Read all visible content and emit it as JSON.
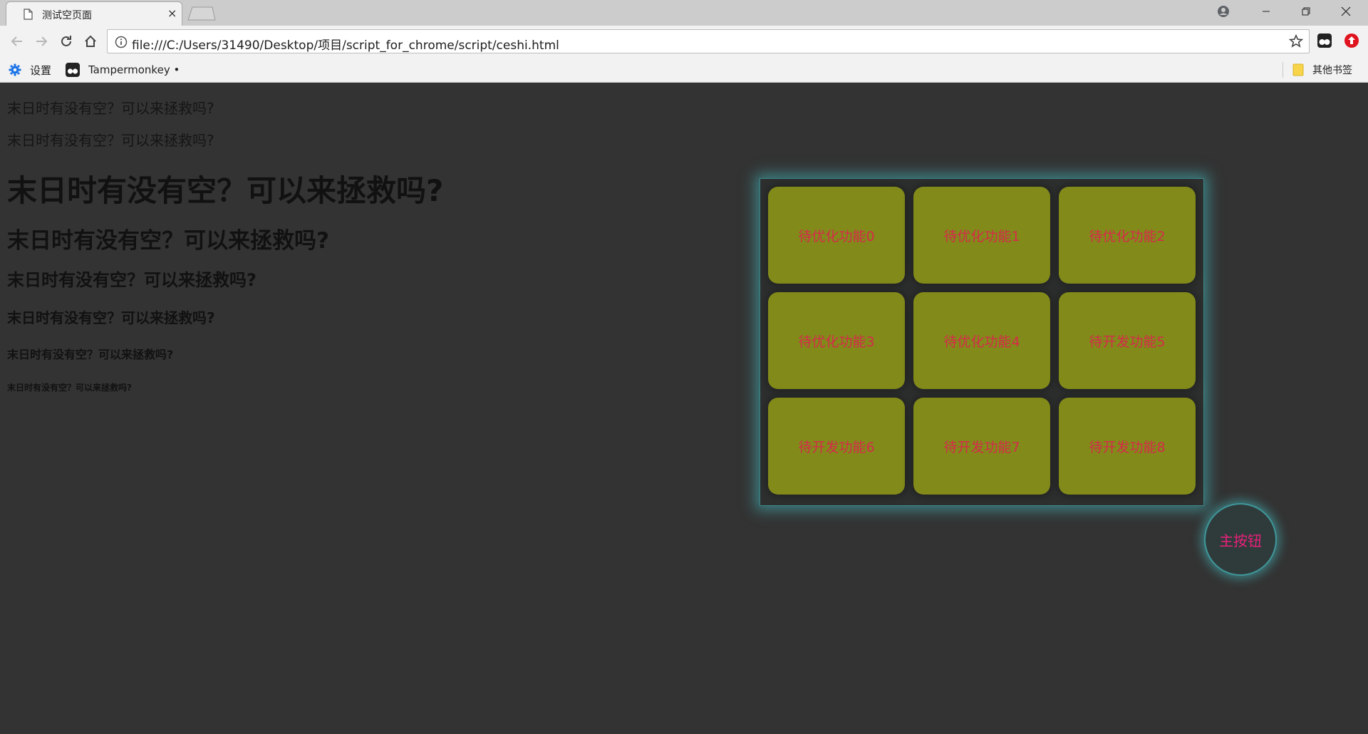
{
  "browser": {
    "tab_title": "测试空页面",
    "tab_close": "×",
    "url": "file:///C:/Users/31490/Desktop/项目/script_for_chrome/script/ceshi.html",
    "bookmarks": {
      "settings_label": "设置",
      "tampermonkey_label": "Tampermonkey • ",
      "other_label": "其他书签"
    }
  },
  "content": {
    "paragraph1": "末日时有没有空？可以来拯救吗?",
    "paragraph2": "末日时有没有空？可以来拯救吗?",
    "heading1": "末日时有没有空？可以来拯救吗?",
    "heading2": "末日时有没有空？可以来拯救吗?",
    "heading3": "末日时有没有空？可以来拯救吗?",
    "heading4": "末日时有没有空？可以来拯救吗?",
    "heading5": "末日时有没有空？可以来拯救吗?",
    "heading6": "末日时有没有空？可以来拯救吗?"
  },
  "panel": {
    "buttons": [
      "待优化功能0",
      "待优化功能1",
      "待优化功能2",
      "待优化功能3",
      "待优化功能4",
      "待开发功能5",
      "待开发功能6",
      "待开发功能7",
      "待开发功能8"
    ],
    "main_button": "主按钮"
  },
  "colors": {
    "page_bg": "#333333",
    "function_button_bg": "#828a1a",
    "function_button_text": "#d62a4a",
    "glow": "#46bec3",
    "main_button_text": "#e8207a"
  }
}
